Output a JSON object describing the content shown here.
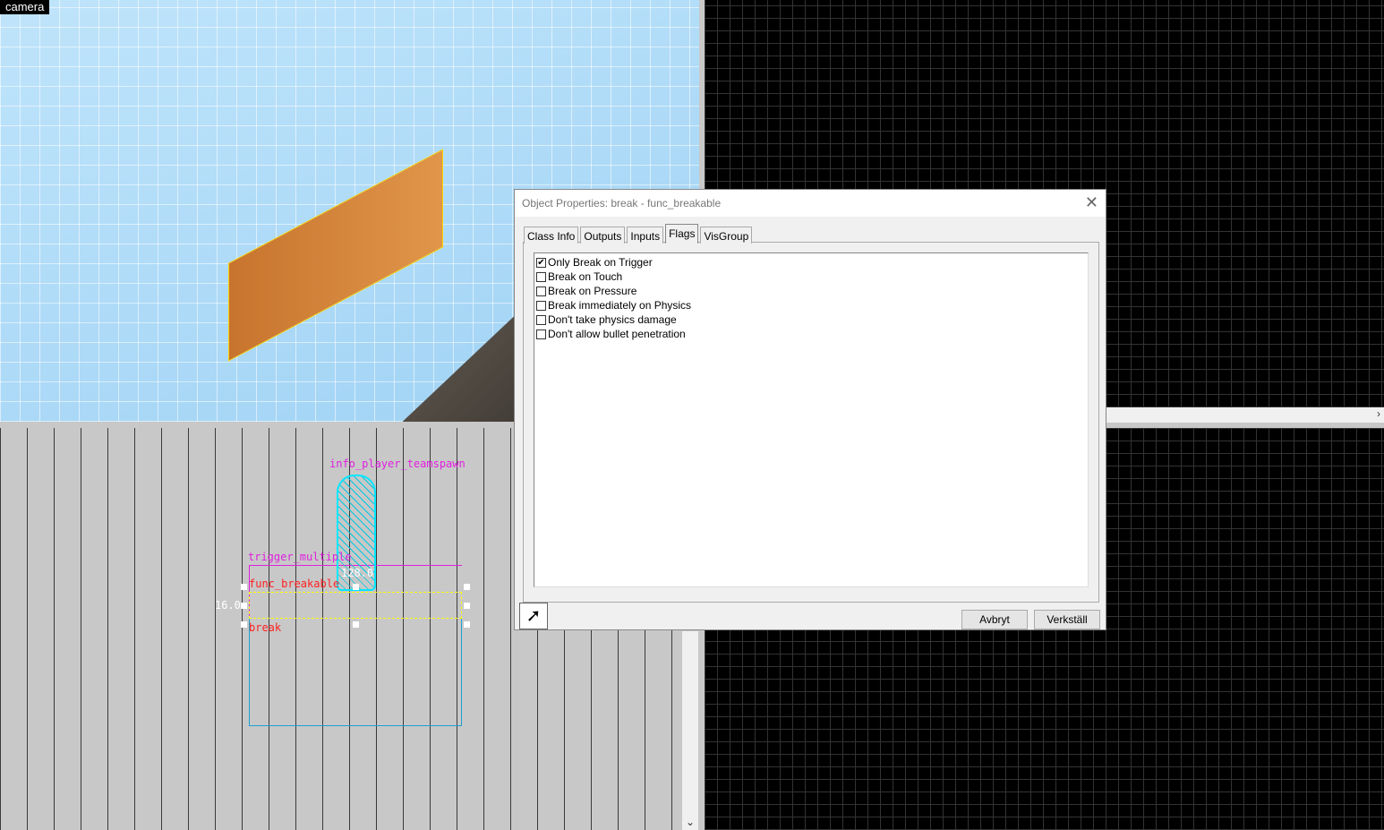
{
  "camera": {
    "label": "camera"
  },
  "viewport_front": {
    "labels": {
      "entity": "info_player_teamspawn",
      "trigger": "trigger_multiple",
      "breakable": "func_breakable",
      "name": "break",
      "width": "128.0",
      "height": "16.0"
    }
  },
  "dialog": {
    "title": "Object Properties: break - func_breakable",
    "tabs": [
      {
        "label": "Class Info"
      },
      {
        "label": "Outputs"
      },
      {
        "label": "Inputs"
      },
      {
        "label": "Flags",
        "active": true
      },
      {
        "label": "VisGroup"
      }
    ],
    "flags": [
      {
        "label": "Only Break on Trigger",
        "checked": true
      },
      {
        "label": "Break on Touch",
        "checked": false
      },
      {
        "label": "Break on Pressure",
        "checked": false
      },
      {
        "label": "Break immediately on Physics",
        "checked": false
      },
      {
        "label": "Don't take physics damage",
        "checked": false
      },
      {
        "label": "Don't allow bullet penetration",
        "checked": false
      }
    ],
    "cancel_label": "Avbryt",
    "apply_label": "Verkställ",
    "picker_icon": "eyedropper-pointer-icon"
  },
  "colors": {
    "entity": "#e020e0",
    "brush": "#ff2020",
    "selection": "#ffff00",
    "sky": "#a8d8f8"
  }
}
